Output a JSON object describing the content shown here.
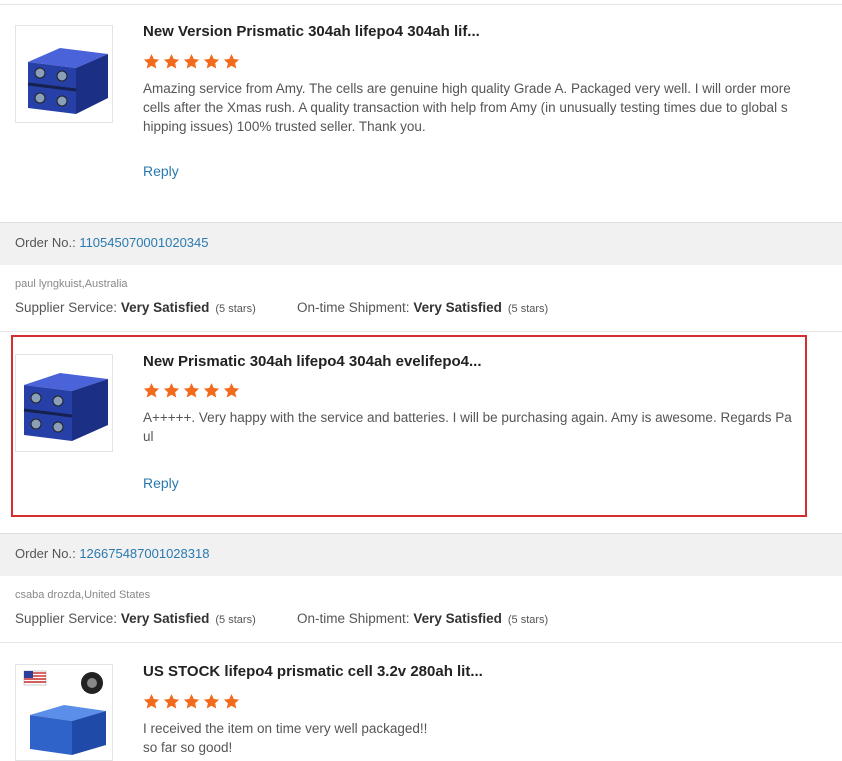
{
  "reviews": [
    {
      "title": "New Version Prismatic 304ah lifepo4 304ah lif...",
      "rating": 5,
      "text": "Amazing service from Amy. The cells are genuine high quality Grade A. Packaged very well. I will order more cells after the Xmas rush. A quality transaction with help from Amy (in unusually testing times due to global shipping issues) 100% trusted seller.  Thank you.",
      "reply_label": "Reply",
      "icon": "battery-product-image"
    },
    {
      "title": "New Prismatic 304ah lifepo4 304ah evelifepo4...",
      "rating": 5,
      "text": "A+++++. Very happy with the service and batteries. I will be purchasing again. Amy is awesome. Regards Paul",
      "reply_label": "Reply",
      "icon": "battery-product-image"
    },
    {
      "title": "US STOCK lifepo4 prismatic cell 3.2v 280ah lit...",
      "rating": 5,
      "text_line1": "I received the item on time  very well packaged!!",
      "text_line2": "so far so good!",
      "icon": "us-stock-battery-image"
    }
  ],
  "orders": [
    {
      "order_label": "Order No.:",
      "order_number": "110545070001020345",
      "buyer": "paul lyngkuist,Australia",
      "supplier_label": "Supplier Service:",
      "supplier_value": "Very Satisfied",
      "supplier_stars": "(5 stars)",
      "shipment_label": "On-time Shipment:",
      "shipment_value": "Very Satisfied",
      "shipment_stars": "(5 stars)"
    },
    {
      "order_label": "Order No.:",
      "order_number": "126675487001028318",
      "buyer": "csaba drozda,United States",
      "supplier_label": "Supplier Service:",
      "supplier_value": "Very Satisfied",
      "supplier_stars": "(5 stars)",
      "shipment_label": "On-time Shipment:",
      "shipment_value": "Very Satisfied",
      "shipment_stars": "(5 stars)"
    }
  ],
  "colors": {
    "star": "#f26a1b",
    "link": "#2a7ab0",
    "highlight": "#d32f2f",
    "battery_blue": "#2b45b8"
  }
}
